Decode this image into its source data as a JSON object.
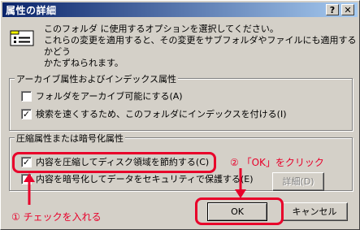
{
  "window": {
    "title": "属性の詳細",
    "help_label": "?",
    "close_label": "✕"
  },
  "description": {
    "line1": "このフォルダ に使用するオプションを選択してください。",
    "line2": "これらの変更を適用すると、その変更をサブフォルダやファイルにも適用するかどう",
    "line3": "かたずねられます。"
  },
  "archive_group": {
    "label": "アーカイブ属性およびインデックス属性",
    "items": [
      {
        "label": "フォルダをアーカイブ可能にする(A)",
        "checked": false
      },
      {
        "label": "検索を速くするため、このフォルダにインデックスを付ける(I)",
        "checked": true
      }
    ]
  },
  "compress_group": {
    "label": "圧縮属性または暗号化属性",
    "items": [
      {
        "label": "内容を圧縮してディスク領域を節約する(C)",
        "checked": true
      },
      {
        "label": "内容を暗号化してデータをセキュリティで保護する(E)",
        "checked": false
      }
    ],
    "detail_button": "詳細(D)"
  },
  "buttons": {
    "ok": "OK",
    "cancel": "キャンセル"
  },
  "annotations": {
    "step1": "① チェックを入れる",
    "step2": "② 「OK」をクリック",
    "color": "#e8002a"
  }
}
